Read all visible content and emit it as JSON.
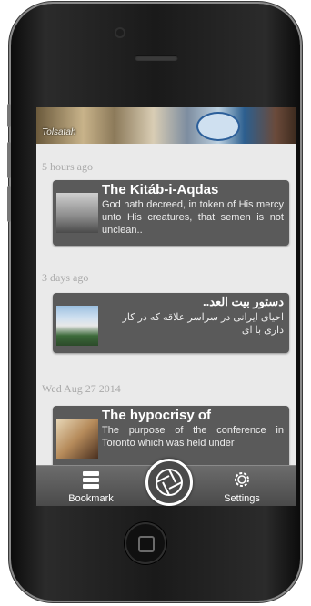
{
  "banner": {
    "text": "Tolsatah"
  },
  "feed": [
    {
      "date": "5 hours ago",
      "title": "The Kitáb-i-Aqdas",
      "excerpt": "God hath decreed, in token of His mercy unto His creatures, that semen is not unclean..",
      "rtl": false
    },
    {
      "date": "3 days ago",
      "title": "دستور بیت العد..",
      "excerpt": "احیای ایرانی در سراسر علاقه که در کار داری با ای",
      "rtl": true
    },
    {
      "date": "Wed Aug 27 2014",
      "title": "The hypocrisy of",
      "excerpt": "The purpose of the conference in Toronto which was held under",
      "rtl": false
    }
  ],
  "tabbar": {
    "bookmark_label": "Bookmark",
    "settings_label": "Settings"
  },
  "colors": {
    "card_bg": "#5a5a5a",
    "screen_bg": "#eaeaea",
    "date_text": "#a9a9a9"
  }
}
